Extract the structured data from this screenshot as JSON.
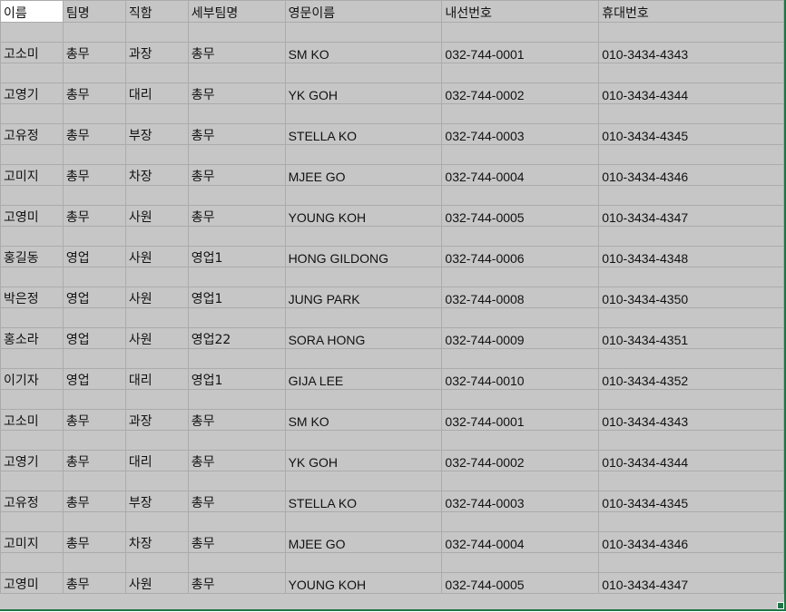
{
  "headers": [
    "이름",
    "팀명",
    "직함",
    "세부팀명",
    "영문이름",
    "내선번호",
    "휴대번호"
  ],
  "rows": [
    [
      "고소미",
      "총무",
      "과장",
      "총무",
      "SM KO",
      "032-744-0001",
      "010-3434-4343"
    ],
    [
      "고영기",
      "총무",
      "대리",
      "총무",
      "YK GOH",
      "032-744-0002",
      "010-3434-4344"
    ],
    [
      "고유정",
      "총무",
      "부장",
      "총무",
      "STELLA KO",
      "032-744-0003",
      "010-3434-4345"
    ],
    [
      "고미지",
      "총무",
      "차장",
      "총무",
      "MJEE GO",
      "032-744-0004",
      "010-3434-4346"
    ],
    [
      "고영미",
      "총무",
      "사원",
      "총무",
      "YOUNG KOH",
      "032-744-0005",
      "010-3434-4347"
    ],
    [
      "홍길동",
      "영업",
      "사원",
      "영업1",
      "HONG GILDONG",
      "032-744-0006",
      "010-3434-4348"
    ],
    [
      "박은정",
      "영업",
      "사원",
      "영업1",
      "JUNG PARK",
      "032-744-0008",
      "010-3434-4350"
    ],
    [
      "홍소라",
      "영업",
      "사원",
      "영업22",
      "SORA HONG",
      "032-744-0009",
      "010-3434-4351"
    ],
    [
      "이기자",
      "영업",
      "대리",
      "영업1",
      "GIJA LEE",
      "032-744-0010",
      "010-3434-4352"
    ],
    [
      "고소미",
      "총무",
      "과장",
      "총무",
      "SM KO",
      "032-744-0001",
      "010-3434-4343"
    ],
    [
      "고영기",
      "총무",
      "대리",
      "총무",
      "YK GOH",
      "032-744-0002",
      "010-3434-4344"
    ],
    [
      "고유정",
      "총무",
      "부장",
      "총무",
      "STELLA KO",
      "032-744-0003",
      "010-3434-4345"
    ],
    [
      "고미지",
      "총무",
      "차장",
      "총무",
      "MJEE GO",
      "032-744-0004",
      "010-3434-4346"
    ],
    [
      "고영미",
      "총무",
      "사원",
      "총무",
      "YOUNG KOH",
      "032-744-0005",
      "010-3434-4347"
    ]
  ],
  "colors": {
    "cell_background": "#c6c6c6",
    "active_cell_background": "#ffffff",
    "gridline": "#ababab",
    "selection_border": "#217346"
  }
}
